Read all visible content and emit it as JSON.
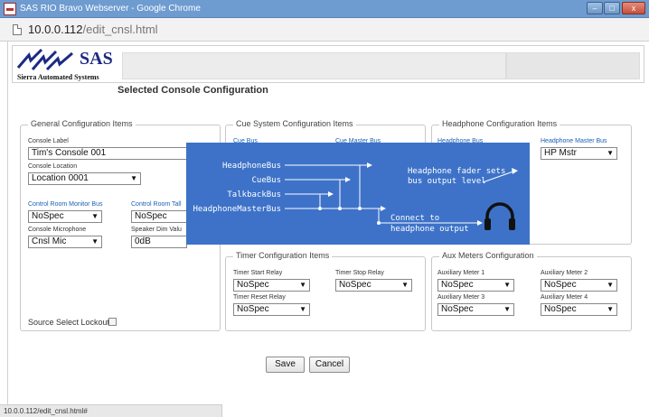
{
  "window": {
    "title": "SAS RIO Bravo Webserver - Google Chrome"
  },
  "address": {
    "host": "10.0.0.112",
    "path": "/edit_cnsl.html"
  },
  "logo": {
    "brand": "SAS",
    "company": "Sierra Automated Systems"
  },
  "page_title": "Selected Console Configuration",
  "general": {
    "legend": "General Configuration Items",
    "console_label": {
      "label": "Console Label",
      "value": "Tim's Console 001"
    },
    "console_location": {
      "label": "Console Location",
      "value": "Location 0001"
    },
    "cr_monitor_bus": {
      "label": "Control Room Monitor Bus",
      "value": "NoSpec"
    },
    "cr_talkback": {
      "label": "Control Room Tall",
      "value": "NoSpec"
    },
    "console_microphone": {
      "label": "Console Microphone",
      "value": "Cnsl Mic"
    },
    "speaker_dim": {
      "label": "Speaker Dim Valu",
      "value": "0dB"
    },
    "source_select_lockout": "Source Select Lockout"
  },
  "cue": {
    "legend": "Cue System Configuration Items",
    "cue_bus": "Cue Bus",
    "cue_master_bus": "Cue Master Bus"
  },
  "headphone": {
    "legend": "Headphone Configuration Items",
    "headphone_bus": "Headphone Bus",
    "headphone_master_bus": {
      "label": "Headphone Master Bus",
      "value": "HP Mstr"
    }
  },
  "timer": {
    "legend": "Timer Configuration Items",
    "start_relay": {
      "label": "Timer Start Relay",
      "value": "NoSpec"
    },
    "stop_relay": {
      "label": "Timer Stop Relay",
      "value": "NoSpec"
    },
    "reset_relay": {
      "label": "Timer Reset Relay",
      "value": "NoSpec"
    }
  },
  "aux": {
    "legend": "Aux Meters Configuration",
    "meter1": {
      "label": "Auxiliary Meter 1",
      "value": "NoSpec"
    },
    "meter2": {
      "label": "Auxiliary Meter 2",
      "value": "NoSpec"
    },
    "meter3": {
      "label": "Auxiliary Meter 3",
      "value": "NoSpec"
    },
    "meter4": {
      "label": "Auxiliary Meter 4",
      "value": "NoSpec"
    }
  },
  "diagram": {
    "bus1": "HeadphoneBus",
    "bus2": "CueBus",
    "bus3": "TalkbackBus",
    "bus4": "HeadphoneMasterBus",
    "note_line1": "Headphone fader sets",
    "note_line2": "bus output level",
    "connect_line1": "Connect to",
    "connect_line2": "headphone output",
    "icon": "headphones-icon"
  },
  "buttons": {
    "save": "Save",
    "cancel": "Cancel"
  },
  "status": "10.0.0.112/edit_cnsl.html#"
}
